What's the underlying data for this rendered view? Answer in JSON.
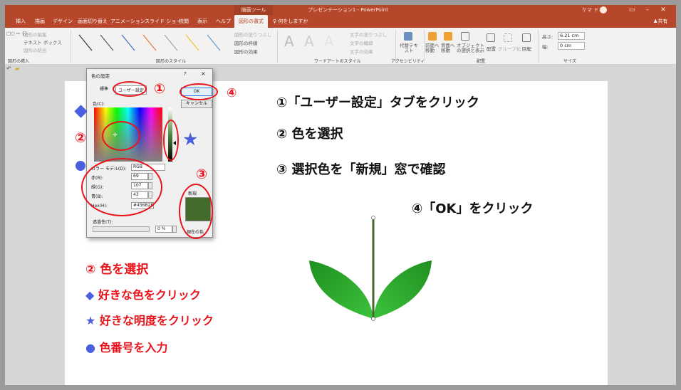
{
  "window": {
    "context_tab_group": "描画ツール",
    "title": "プレゼンテーション1 - PowerPoint",
    "user": "ケマ ドコ"
  },
  "tabs": [
    "挿入",
    "描画",
    "デザイン",
    "画面切り替え",
    "アニメーション",
    "スライド ショー",
    "校閲",
    "表示",
    "ヘルプ",
    "図形の書式"
  ],
  "tell_me": "何をしますか",
  "share": "共有",
  "ribbon": {
    "insert_shapes": {
      "edit_shape": "図形の編集",
      "textbox": "テキスト ボックス",
      "merge_shapes": "図形の結合",
      "label": "図形の挿入"
    },
    "shape_styles": {
      "fill": "図形の塗りつぶし",
      "outline": "図形の枠線",
      "effects": "図形の効果",
      "label": "図形のスタイル"
    },
    "wordart": {
      "letters": [
        "A",
        "A",
        "A"
      ],
      "text_fill": "文字の塗りつぶし",
      "text_outline": "文字の輪郭",
      "text_effects": "文字の効果",
      "label": "ワードアートのスタイル"
    },
    "accessibility": {
      "alt_text": "代替テキスト",
      "label": "アクセシビリティ"
    },
    "arrange": {
      "bring_forward": "前面へ移動",
      "send_backward": "背面へ移動",
      "selection_pane": "オブジェクトの選択と表示",
      "align": "配置",
      "group": "グループ化",
      "rotate": "回転",
      "label": "配置"
    },
    "size": {
      "height_label": "高さ:",
      "height_value": "6.21 cm",
      "width_label": "幅:",
      "width_value": "0 cm",
      "label": "サイズ"
    }
  },
  "dialog": {
    "title": "色の設定",
    "help": "?",
    "close": "×",
    "tab_standard": "標準",
    "tab_custom": "ユーザー設定",
    "ok": "OK",
    "cancel": "キャンセル",
    "colors_label": "色(C):",
    "color_model_label": "カラー モデル(D):",
    "color_model_value": "RGB",
    "red_label": "赤(R):",
    "red_value": "69",
    "green_label": "緑(G):",
    "green_value": "107",
    "blue_label": "青(B):",
    "blue_value": "43",
    "hex_label": "Hex(H):",
    "hex_value": "#456B2B",
    "transparency_label": "透過性(T):",
    "transparency_value": "0 %",
    "new_label": "新規",
    "current_label": "現在の色"
  },
  "annotations": {
    "n1": "①",
    "n2": "②",
    "n3": "③",
    "n4": "④",
    "steps": {
      "s1": "①「ユーザー設定」タブをクリック",
      "s2": "② 色を選択",
      "s3": "③ 選択色を「新規」窓で確認",
      "s4": "④「OK」をクリック"
    },
    "legend_head": "② 色を選択",
    "legend_items": [
      {
        "symbol": "◆",
        "text": "好きな色をクリック"
      },
      {
        "symbol": "★",
        "text": "好きな明度をクリック"
      },
      {
        "symbol": "●",
        "text": "色番号を入力"
      }
    ]
  },
  "colors": {
    "accent": "#b7472a",
    "annotation_red": "#e8141b",
    "annotation_blue": "#4a5fe0",
    "chosen_color": "#456B2B",
    "leaf_green": "#22a022"
  }
}
